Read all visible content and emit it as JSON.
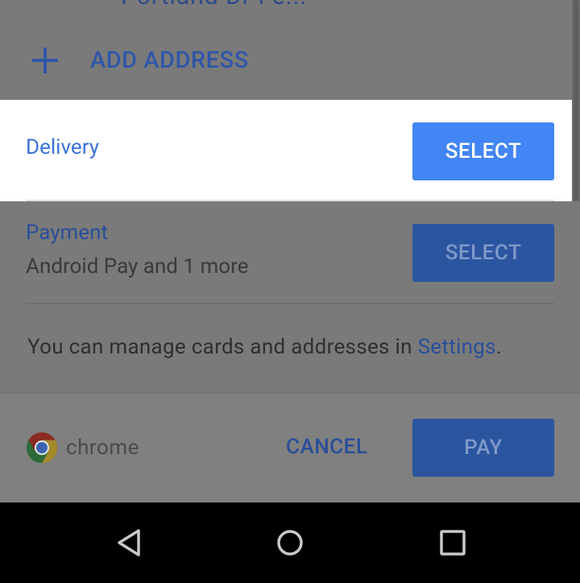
{
  "top_sheet": {
    "cut_off_text": "Portland Dr Fe...",
    "add_address": {
      "label": "ADD ADDRESS",
      "icon": "plus-icon"
    }
  },
  "delivery": {
    "label": "Delivery",
    "select_label": "SELECT"
  },
  "payment": {
    "label": "Payment",
    "subtitle": "Android Pay and 1 more",
    "select_label": "SELECT"
  },
  "note": {
    "text": "You can manage cards and addresses in ",
    "link": "Settings",
    "suffix": "."
  },
  "footer": {
    "brand": "chrome",
    "cancel_label": "CANCEL",
    "pay_label": "PAY"
  },
  "nav_bar": {
    "back_icon": "back-triangle-icon",
    "home_icon": "home-circle-icon",
    "recents_icon": "recents-square-icon"
  },
  "colors": {
    "accent": "#4285f4",
    "link_blue": "#3b73d6",
    "scrim": "#7a7a7a"
  }
}
